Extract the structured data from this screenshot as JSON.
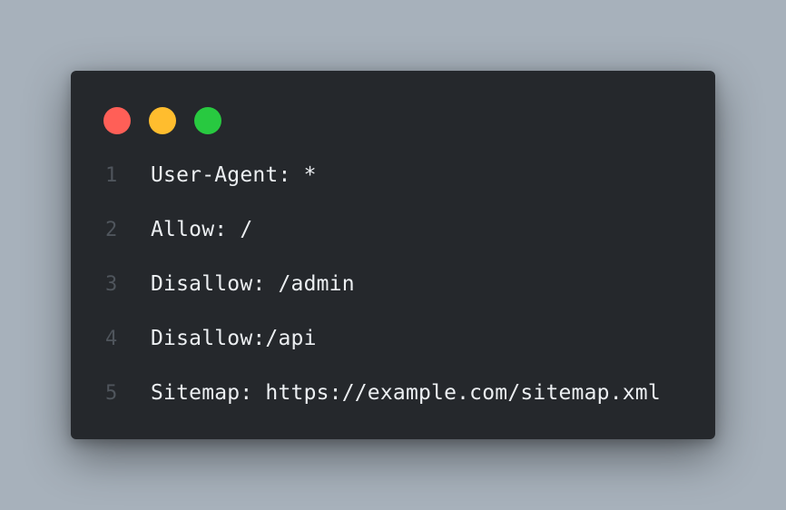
{
  "window": {
    "background": "#25282c",
    "controls": [
      {
        "name": "close",
        "color": "#ff5f57"
      },
      {
        "name": "minimize",
        "color": "#ffbd2e"
      },
      {
        "name": "maximize",
        "color": "#28c940"
      }
    ]
  },
  "code": {
    "lines": [
      {
        "number": "1",
        "text": "User-Agent: *"
      },
      {
        "number": "2",
        "text": "Allow: /"
      },
      {
        "number": "3",
        "text": "Disallow: /admin"
      },
      {
        "number": "4",
        "text": "Disallow:/api"
      },
      {
        "number": "5",
        "text": "Sitemap: https://example.com/sitemap.xml"
      }
    ]
  }
}
